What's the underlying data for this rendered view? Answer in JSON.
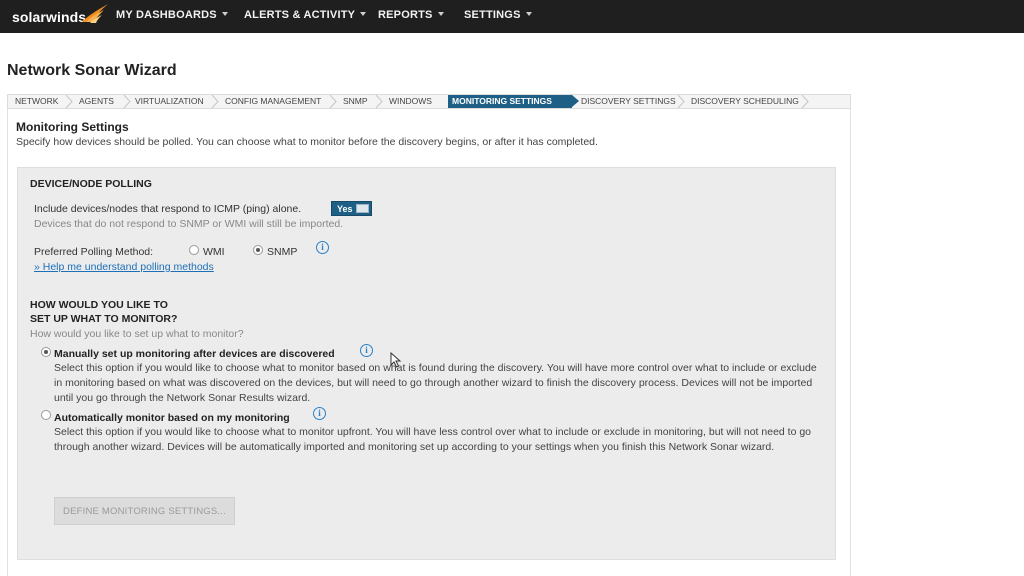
{
  "nav": {
    "logo": "solarwinds",
    "items": [
      {
        "label": "MY DASHBOARDS"
      },
      {
        "label": "ALERTS & ACTIVITY"
      },
      {
        "label": "REPORTS"
      },
      {
        "label": "SETTINGS"
      }
    ]
  },
  "page_title": "Network Sonar Wizard",
  "steps": [
    {
      "label": "NETWORK",
      "active": false
    },
    {
      "label": "AGENTS",
      "active": false
    },
    {
      "label": "VIRTUALIZATION",
      "active": false
    },
    {
      "label": "CONFIG MANAGEMENT",
      "active": false
    },
    {
      "label": "SNMP",
      "active": false
    },
    {
      "label": "WINDOWS",
      "active": false
    },
    {
      "label": "MONITORING SETTINGS",
      "active": true
    },
    {
      "label": "DISCOVERY SETTINGS",
      "active": false
    },
    {
      "label": "DISCOVERY SCHEDULING",
      "active": false
    }
  ],
  "section": {
    "title": "Monitoring Settings",
    "subtitle": "Specify how devices should be polled. You can choose what to monitor before the discovery begins, or after it has completed."
  },
  "polling": {
    "heading": "DEVICE/NODE POLLING",
    "icmp_label": "Include devices/nodes that respond to ICMP (ping) alone.",
    "icmp_toggle": "Yes",
    "icmp_note": "Devices that do not respond to SNMP or WMI will still be imported.",
    "method_label": "Preferred Polling Method:",
    "options": [
      {
        "label": "WMI",
        "checked": false
      },
      {
        "label": "SNMP",
        "checked": true
      }
    ],
    "help_link": "» Help me understand polling methods"
  },
  "setup": {
    "heading_line1": "HOW WOULD YOU LIKE TO",
    "heading_line2": "SET UP WHAT TO MONITOR?",
    "question": "How would you like to set up what to monitor?",
    "manual": {
      "label": "Manually set up monitoring after devices are discovered",
      "checked": true,
      "description": "Select this option if you would like to choose what to monitor based on what is found during the discovery. You will have more control over what to include or exclude in monitoring based on what was discovered on the devices, but will need to go through another wizard to finish the discovery process. Devices will not be imported until you go through the Network Sonar Results wizard."
    },
    "automatic": {
      "label": "Automatically monitor based on my monitoring",
      "checked": false,
      "description": "Select this option if you would like to choose what to monitor upfront. You will have less control over what to include or exclude in monitoring, but will not need to go through another wizard. Devices will be automatically imported and monitoring set up according to your settings when you finish this Network Sonar wizard."
    },
    "define_button": "DEFINE MONITORING SETTINGS..."
  },
  "colors": {
    "nav_bg": "#1f1f1f",
    "accent": "#1e5f86",
    "brand_orange": "#f28c1e",
    "link": "#1d6fb8"
  }
}
